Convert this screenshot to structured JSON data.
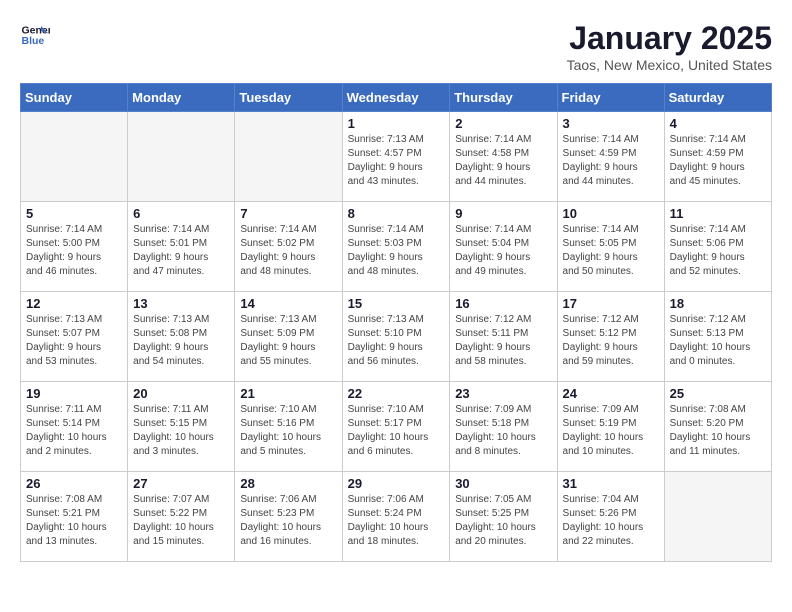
{
  "logo": {
    "line1": "General",
    "line2": "Blue"
  },
  "title": "January 2025",
  "subtitle": "Taos, New Mexico, United States",
  "days_of_week": [
    "Sunday",
    "Monday",
    "Tuesday",
    "Wednesday",
    "Thursday",
    "Friday",
    "Saturday"
  ],
  "weeks": [
    [
      {
        "day": "",
        "info": ""
      },
      {
        "day": "",
        "info": ""
      },
      {
        "day": "",
        "info": ""
      },
      {
        "day": "1",
        "info": "Sunrise: 7:13 AM\nSunset: 4:57 PM\nDaylight: 9 hours\nand 43 minutes."
      },
      {
        "day": "2",
        "info": "Sunrise: 7:14 AM\nSunset: 4:58 PM\nDaylight: 9 hours\nand 44 minutes."
      },
      {
        "day": "3",
        "info": "Sunrise: 7:14 AM\nSunset: 4:59 PM\nDaylight: 9 hours\nand 44 minutes."
      },
      {
        "day": "4",
        "info": "Sunrise: 7:14 AM\nSunset: 4:59 PM\nDaylight: 9 hours\nand 45 minutes."
      }
    ],
    [
      {
        "day": "5",
        "info": "Sunrise: 7:14 AM\nSunset: 5:00 PM\nDaylight: 9 hours\nand 46 minutes."
      },
      {
        "day": "6",
        "info": "Sunrise: 7:14 AM\nSunset: 5:01 PM\nDaylight: 9 hours\nand 47 minutes."
      },
      {
        "day": "7",
        "info": "Sunrise: 7:14 AM\nSunset: 5:02 PM\nDaylight: 9 hours\nand 48 minutes."
      },
      {
        "day": "8",
        "info": "Sunrise: 7:14 AM\nSunset: 5:03 PM\nDaylight: 9 hours\nand 48 minutes."
      },
      {
        "day": "9",
        "info": "Sunrise: 7:14 AM\nSunset: 5:04 PM\nDaylight: 9 hours\nand 49 minutes."
      },
      {
        "day": "10",
        "info": "Sunrise: 7:14 AM\nSunset: 5:05 PM\nDaylight: 9 hours\nand 50 minutes."
      },
      {
        "day": "11",
        "info": "Sunrise: 7:14 AM\nSunset: 5:06 PM\nDaylight: 9 hours\nand 52 minutes."
      }
    ],
    [
      {
        "day": "12",
        "info": "Sunrise: 7:13 AM\nSunset: 5:07 PM\nDaylight: 9 hours\nand 53 minutes."
      },
      {
        "day": "13",
        "info": "Sunrise: 7:13 AM\nSunset: 5:08 PM\nDaylight: 9 hours\nand 54 minutes."
      },
      {
        "day": "14",
        "info": "Sunrise: 7:13 AM\nSunset: 5:09 PM\nDaylight: 9 hours\nand 55 minutes."
      },
      {
        "day": "15",
        "info": "Sunrise: 7:13 AM\nSunset: 5:10 PM\nDaylight: 9 hours\nand 56 minutes."
      },
      {
        "day": "16",
        "info": "Sunrise: 7:12 AM\nSunset: 5:11 PM\nDaylight: 9 hours\nand 58 minutes."
      },
      {
        "day": "17",
        "info": "Sunrise: 7:12 AM\nSunset: 5:12 PM\nDaylight: 9 hours\nand 59 minutes."
      },
      {
        "day": "18",
        "info": "Sunrise: 7:12 AM\nSunset: 5:13 PM\nDaylight: 10 hours\nand 0 minutes."
      }
    ],
    [
      {
        "day": "19",
        "info": "Sunrise: 7:11 AM\nSunset: 5:14 PM\nDaylight: 10 hours\nand 2 minutes."
      },
      {
        "day": "20",
        "info": "Sunrise: 7:11 AM\nSunset: 5:15 PM\nDaylight: 10 hours\nand 3 minutes."
      },
      {
        "day": "21",
        "info": "Sunrise: 7:10 AM\nSunset: 5:16 PM\nDaylight: 10 hours\nand 5 minutes."
      },
      {
        "day": "22",
        "info": "Sunrise: 7:10 AM\nSunset: 5:17 PM\nDaylight: 10 hours\nand 6 minutes."
      },
      {
        "day": "23",
        "info": "Sunrise: 7:09 AM\nSunset: 5:18 PM\nDaylight: 10 hours\nand 8 minutes."
      },
      {
        "day": "24",
        "info": "Sunrise: 7:09 AM\nSunset: 5:19 PM\nDaylight: 10 hours\nand 10 minutes."
      },
      {
        "day": "25",
        "info": "Sunrise: 7:08 AM\nSunset: 5:20 PM\nDaylight: 10 hours\nand 11 minutes."
      }
    ],
    [
      {
        "day": "26",
        "info": "Sunrise: 7:08 AM\nSunset: 5:21 PM\nDaylight: 10 hours\nand 13 minutes."
      },
      {
        "day": "27",
        "info": "Sunrise: 7:07 AM\nSunset: 5:22 PM\nDaylight: 10 hours\nand 15 minutes."
      },
      {
        "day": "28",
        "info": "Sunrise: 7:06 AM\nSunset: 5:23 PM\nDaylight: 10 hours\nand 16 minutes."
      },
      {
        "day": "29",
        "info": "Sunrise: 7:06 AM\nSunset: 5:24 PM\nDaylight: 10 hours\nand 18 minutes."
      },
      {
        "day": "30",
        "info": "Sunrise: 7:05 AM\nSunset: 5:25 PM\nDaylight: 10 hours\nand 20 minutes."
      },
      {
        "day": "31",
        "info": "Sunrise: 7:04 AM\nSunset: 5:26 PM\nDaylight: 10 hours\nand 22 minutes."
      },
      {
        "day": "",
        "info": ""
      }
    ]
  ]
}
